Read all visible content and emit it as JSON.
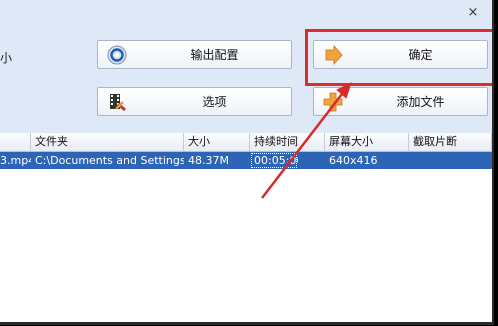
{
  "window": {
    "close_glyph": "×",
    "partial_label": "小"
  },
  "buttons": {
    "output_config": "输出配置",
    "options": "选项",
    "ok": "确定",
    "add_file": "添加文件"
  },
  "table": {
    "columns": [
      "文件夹",
      "大小",
      "持续时间",
      "屏幕大小",
      "截取片断"
    ],
    "rows": [
      {
        "name_partial": "3.mp4",
        "folder": "C:\\Documents and Settings\\...",
        "size": "48.37M",
        "duration": "00:05:00",
        "screen": "640x416",
        "clip": ""
      }
    ]
  },
  "colors": {
    "highlight": "#e02b2b",
    "row_selected": "#2d64b6",
    "window_bg": "#dfe8f6"
  }
}
